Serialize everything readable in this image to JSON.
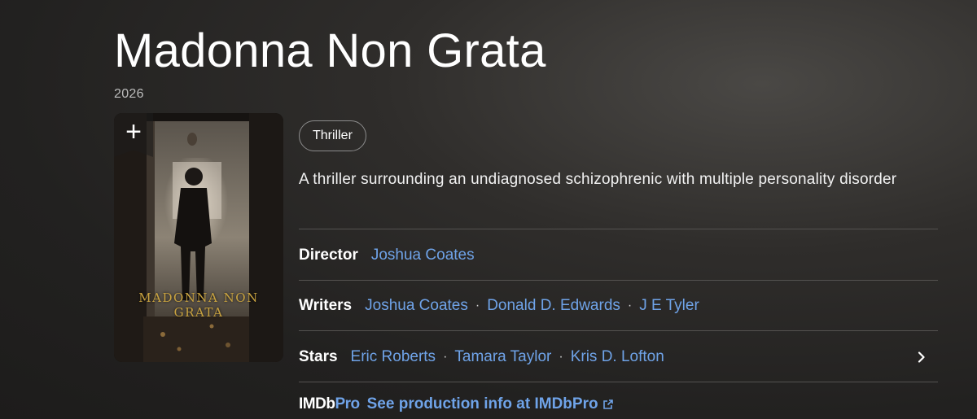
{
  "title": "Madonna Non Grata",
  "year": "2026",
  "poster": {
    "add_label": "+",
    "text": "MADONNA NON GRATA"
  },
  "genres": [
    "Thriller"
  ],
  "plot": "A thriller surrounding an undiagnosed schizophrenic with multiple personality disorder",
  "credits": {
    "director": {
      "label": "Director",
      "names": [
        "Joshua Coates"
      ]
    },
    "writers": {
      "label": "Writers",
      "names": [
        "Joshua Coates",
        "Donald D. Edwards",
        "J E Tyler"
      ]
    },
    "stars": {
      "label": "Stars",
      "names": [
        "Eric Roberts",
        "Tamara Taylor",
        "Kris D. Lofton"
      ]
    },
    "separator": "·"
  },
  "imdbpro": {
    "logo_main": "IMDb",
    "logo_suffix": "Pro",
    "link_text": "See production info at IMDbPro"
  },
  "colors": {
    "link": "#6fa3e8",
    "background": "#2a2928",
    "poster_text": "#c9a340"
  },
  "icons": {
    "add": "plus-icon",
    "chevron": "chevron-right-icon",
    "external": "external-link-icon"
  }
}
